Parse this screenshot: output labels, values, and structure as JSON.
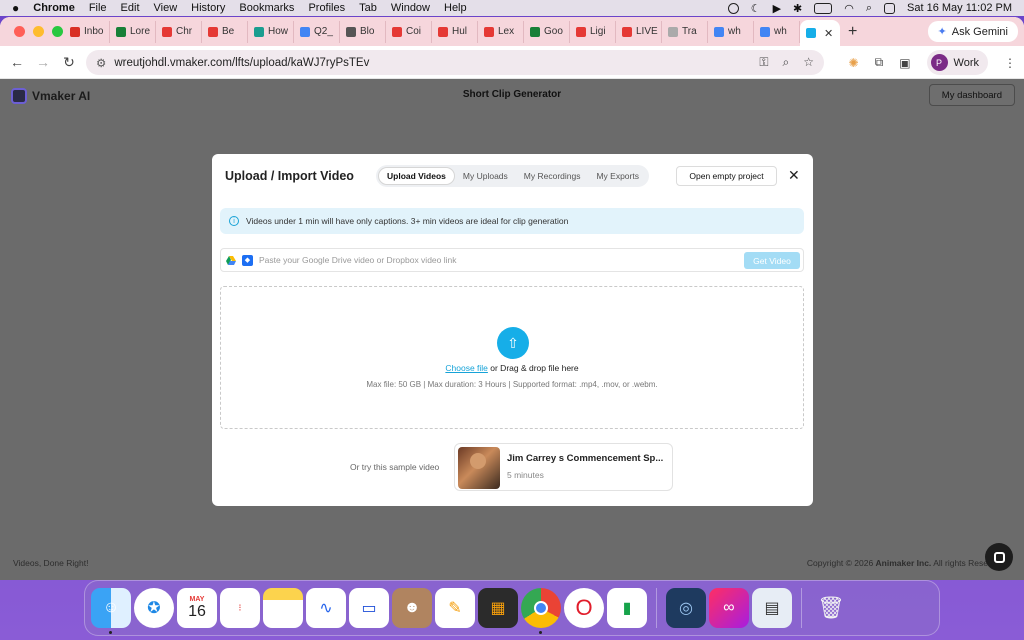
{
  "menubar": {
    "apple": "",
    "app": "Chrome",
    "items": [
      "File",
      "Edit",
      "View",
      "History",
      "Bookmarks",
      "Profiles",
      "Tab",
      "Window",
      "Help"
    ],
    "datetime": "Sat 16 May  11:02 PM"
  },
  "browser": {
    "tabs": [
      {
        "label": "Inbo",
        "color": "#d93025"
      },
      {
        "label": "Lore",
        "color": "#188038"
      },
      {
        "label": "Chr",
        "color": "#e53935"
      },
      {
        "label": "Be",
        "color": "#e53935"
      },
      {
        "label": "How",
        "color": "#1a9d8f"
      },
      {
        "label": "Q2_",
        "color": "#4285f4"
      },
      {
        "label": "Blo",
        "color": "#555555"
      },
      {
        "label": "Coi",
        "color": "#e53935"
      },
      {
        "label": "Hul",
        "color": "#e53935"
      },
      {
        "label": "Lex",
        "color": "#e53935"
      },
      {
        "label": "Goo",
        "color": "#188038"
      },
      {
        "label": "Ligi",
        "color": "#e53935"
      },
      {
        "label": "LIVE",
        "color": "#e53935"
      },
      {
        "label": "Tra",
        "color": "#aaaaaa"
      },
      {
        "label": "wh",
        "color": "#4285f4"
      },
      {
        "label": "wh",
        "color": "#4285f4"
      }
    ],
    "active_tab_close": "✕",
    "ask_gemini": "Ask Gemini",
    "url": "wreutjohdl.vmaker.com/lfts/upload/kaWJ7ryPsTEv",
    "profile_initial": "P",
    "profile_label": "Work"
  },
  "app": {
    "brand": "Vmaker AI",
    "title": "Short Clip Generator",
    "dashboard_btn": "My dashboard",
    "footer_left": "Videos, Done Right!",
    "footer_right_pre": "Copyright © 2026 ",
    "footer_right_brand": "Animaker Inc.",
    "footer_right_post": " All rights Rese"
  },
  "modal": {
    "title": "Upload / Import Video",
    "tabs": [
      "Upload Videos",
      "My Uploads",
      "My Recordings",
      "My Exports"
    ],
    "selected_tab": "Upload Videos",
    "open_empty": "Open empty project",
    "info": "Videos under 1 min will have only captions. 3+ min videos are ideal for clip generation",
    "link_placeholder": "Paste your Google Drive video or Dropbox video link",
    "get_video": "Get Video",
    "choose_file": "Choose file",
    "drop_text": " or Drag & drop file here",
    "drop_meta": "Max file: 50 GB | Max duration: 3 Hours | Supported format: .mp4, .mov, or .webm.",
    "sample_label": "Or try this sample video",
    "sample_title": "Jim Carrey s Commencement Sp...",
    "sample_duration": "5 minutes"
  },
  "dock": {
    "calendar_month": "MAY",
    "calendar_day": "16",
    "apps": [
      "finder",
      "safari",
      "calendar",
      "reminders",
      "notes",
      "freeform",
      "keynote",
      "contacts",
      "pages",
      "calculator",
      "chrome",
      "opera",
      "numbers",
      "quicktime",
      "creative-cloud",
      "preview",
      "trash"
    ]
  }
}
